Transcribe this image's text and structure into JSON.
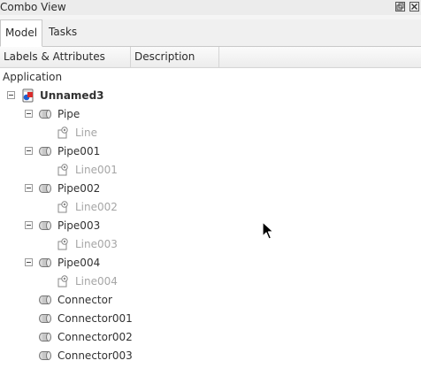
{
  "window": {
    "title": "Combo View"
  },
  "tabs": [
    {
      "label": "Model",
      "active": true
    },
    {
      "label": "Tasks",
      "active": false
    }
  ],
  "columns": [
    {
      "label": "Labels & Attributes"
    },
    {
      "label": "Description"
    }
  ],
  "tree": {
    "root_label": "Application",
    "document": "Unnamed3",
    "items": [
      {
        "label": "Pipe",
        "child": "Line"
      },
      {
        "label": "Pipe001",
        "child": "Line001"
      },
      {
        "label": "Pipe002",
        "child": "Line002"
      },
      {
        "label": "Pipe003",
        "child": "Line003"
      },
      {
        "label": "Pipe004",
        "child": "Line004"
      }
    ],
    "connectors": [
      {
        "label": "Connector"
      },
      {
        "label": "Connector001"
      },
      {
        "label": "Connector002"
      },
      {
        "label": "Connector003"
      }
    ]
  },
  "icons": {
    "float": "float-icon",
    "close": "close-icon",
    "document": "document-icon",
    "pipe": "pipe-part-icon",
    "line": "sketch-line-icon",
    "cursor": "mouse-cursor-icon"
  }
}
